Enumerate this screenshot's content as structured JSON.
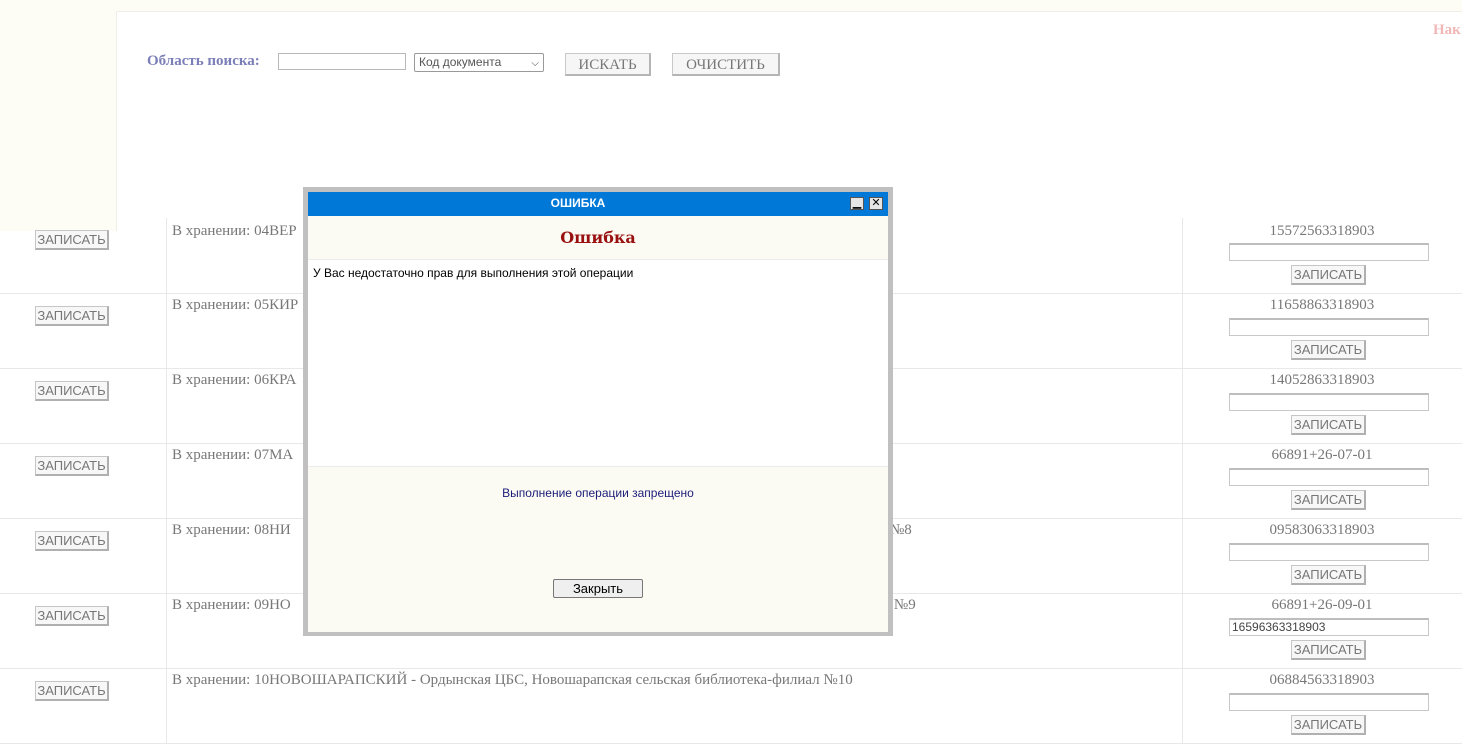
{
  "search": {
    "label": "Область поиска:",
    "input_value": "",
    "select_value": "Код документа",
    "find_button": "ИСКАТЬ",
    "clear_button": "ОЧИСТИТЬ",
    "top_right_text": "Нак"
  },
  "rows": [
    {
      "save_left": "ЗАПИСАТЬ",
      "storage": "В хранении: 04ВЕР",
      "code": "15572563318903",
      "input_value": "",
      "save_right": "ЗАПИСАТЬ"
    },
    {
      "save_left": "ЗАПИСАТЬ",
      "storage": "В хранении: 05КИР",
      "code": "11658863318903",
      "input_value": "",
      "save_right": "ЗАПИСАТЬ"
    },
    {
      "save_left": "ЗАПИСАТЬ",
      "storage": "В хранении: 06КРА",
      "code": "14052863318903",
      "input_value": "",
      "save_right": "ЗАПИСАТЬ"
    },
    {
      "save_left": "ЗАПИСАТЬ",
      "storage": "В хранении: 07МА",
      "code": "66891+26-07-01",
      "input_value": "",
      "save_right": "ЗАПИСАТЬ"
    },
    {
      "save_left": "ЗАПИСАТЬ",
      "storage": "В хранении: 08НИ",
      "storage_tail": "№8",
      "code": "09583063318903",
      "input_value": "",
      "save_right": "ЗАПИСАТЬ"
    },
    {
      "save_left": "ЗАПИСАТЬ",
      "storage": "В хранении: 09НО",
      "storage_tail": "t №9",
      "code": "66891+26-09-01",
      "input_value": "16596363318903",
      "save_right": "ЗАПИСАТЬ"
    },
    {
      "save_left": "ЗАПИСАТЬ",
      "storage": "В хранении: 10НОВОШАРАПСКИЙ - Ордынская ЦБС, Новошарапская сельская библиотека-филиал №10",
      "code": "06884563318903",
      "input_value": "",
      "save_right": "ЗАПИСАТЬ"
    }
  ],
  "modal": {
    "title": "ОШИБКА",
    "heading": "Ошибка",
    "message": "У Вас недостаточно прав для выполнения этой операции",
    "status": "Выполнение операции запрещено",
    "close_button": "Закрыть",
    "minimize_glyph": "▁",
    "close_glyph": "✕"
  },
  "colors": {
    "titlebar": "#0078d7",
    "heading": "#9a1111",
    "search_label": "#7b7fb8"
  }
}
